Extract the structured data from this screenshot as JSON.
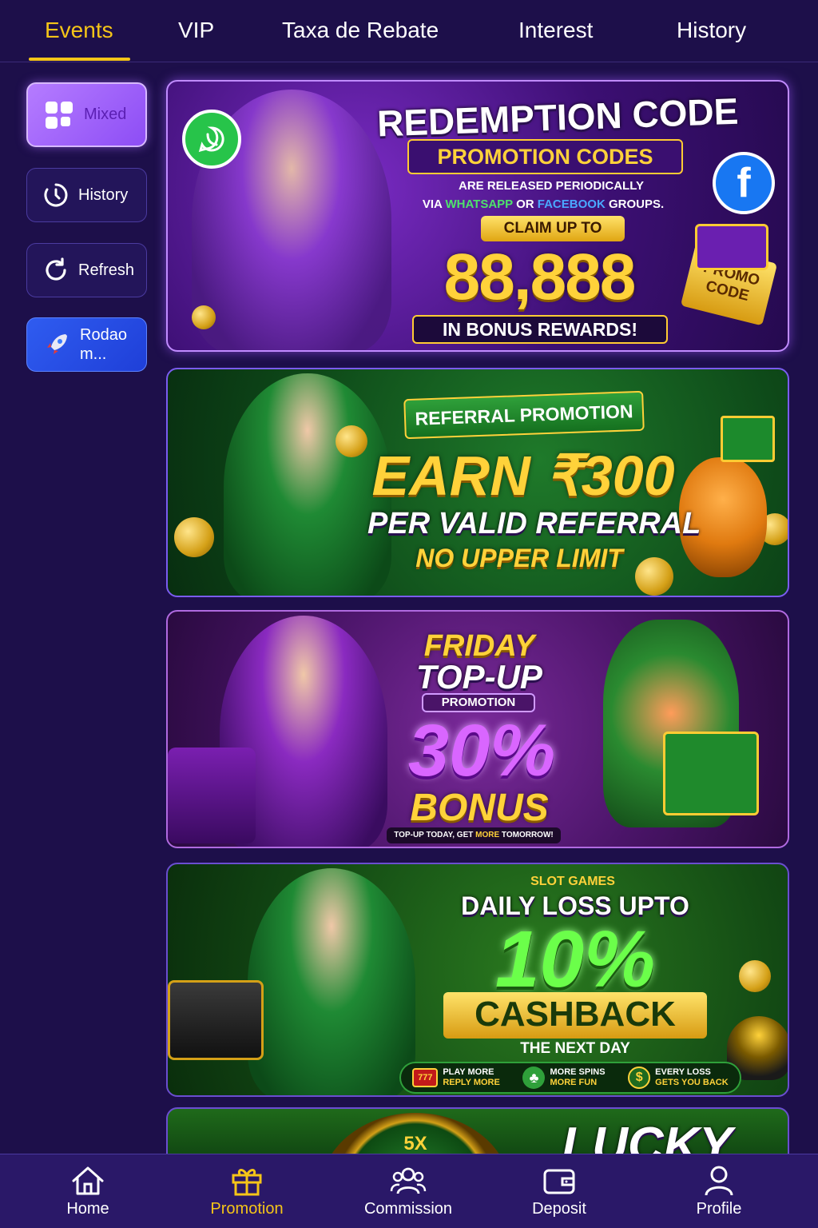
{
  "tabs": [
    {
      "label": "Events",
      "active": true
    },
    {
      "label": "VIP"
    },
    {
      "label": "Taxa de Rebate"
    },
    {
      "label": "Interest"
    },
    {
      "label": "History"
    }
  ],
  "sidebar": {
    "items": [
      {
        "label": "Mixed",
        "icon": "grid-icon"
      },
      {
        "label": "History",
        "icon": "clock-icon"
      },
      {
        "label": "Refresh",
        "icon": "refresh-icon"
      },
      {
        "label": "Rodao m...",
        "line1": "Rodao",
        "line2": "m...",
        "icon": "rocket-icon"
      }
    ]
  },
  "banners": {
    "redemption": {
      "title": "REDEMPTION CODE",
      "subtitle": "PROMOTION CODES",
      "line1": "ARE RELEASED PERIODICALLY",
      "line2_prefix": "VIA",
      "line2_whatsapp": "WHATSAPP",
      "line2_or": "OR",
      "line2_facebook": "FACEBOOK",
      "line2_suffix": "GROUPS.",
      "claim": "CLAIM UP TO",
      "amount": "88,888",
      "rewards": "IN BONUS REWARDS!",
      "promo_tag": "PROMO CODE"
    },
    "referral": {
      "ribbon": "REFERRAL PROMOTION",
      "headline": "EARN ₹300",
      "line1": "PER VALID REFERRAL",
      "line2": "NO UPPER LIMIT"
    },
    "friday": {
      "line1": "FRIDAY",
      "line2": "TOP-UP",
      "tag": "PROMOTION",
      "percent": "30%",
      "bonus": "BONUS",
      "footer_prefix": "TOP-UP TODAY, GET",
      "footer_more": "MORE",
      "footer_suffix": "TOMORROW!"
    },
    "cashback": {
      "tag": "SLOT GAMES",
      "headline": "DAILY LOSS UPTO",
      "percent": "10%",
      "cashback": "CASHBACK",
      "next_day": "THE NEXT DAY",
      "features": [
        {
          "icon": "slot-777-icon",
          "line1": "PLAY MORE",
          "line2": "REPLY MORE"
        },
        {
          "icon": "clover-icon",
          "line1": "MORE SPINS",
          "line2": "MORE FUN"
        },
        {
          "icon": "dollar-coin-icon",
          "line1": "EVERY LOSS",
          "line2": "GETS YOU BACK"
        }
      ]
    },
    "lucky": {
      "multiplier": "5X",
      "title": "LUCKY"
    }
  },
  "bottom_nav": [
    {
      "label": "Home",
      "icon": "home-icon"
    },
    {
      "label": "Promotion",
      "icon": "gift-icon",
      "active": true
    },
    {
      "label": "Commission",
      "icon": "users-icon"
    },
    {
      "label": "Deposit",
      "icon": "wallet-icon"
    },
    {
      "label": "Profile",
      "icon": "user-icon"
    }
  ],
  "colors": {
    "background": "#1d0f4a",
    "accent": "#f5c518",
    "nav_bg": "#2a1868"
  }
}
